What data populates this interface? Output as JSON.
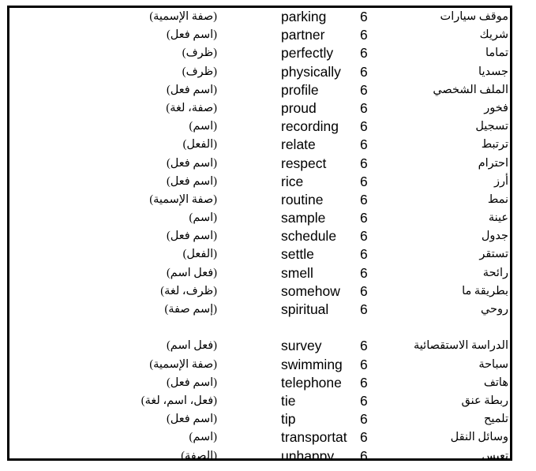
{
  "document": {
    "type": "vocabulary-table",
    "columns": [
      "part_of_speech",
      "english_word",
      "level",
      "arabic_meaning"
    ],
    "clipped_top_artifacts": [
      "..",
      "."
    ],
    "rows": [
      {
        "pos": "(صفة الإسمية)",
        "en": "parking",
        "num": "6",
        "ar": "موقف سيارات"
      },
      {
        "pos": "(اسم فعل)",
        "en": "partner",
        "num": "6",
        "ar": "شريك"
      },
      {
        "pos": "(ظرف)",
        "en": "perfectly",
        "num": "6",
        "ar": "تماما"
      },
      {
        "pos": "(ظرف)",
        "en": "physically",
        "num": "6",
        "ar": "جسديا"
      },
      {
        "pos": "(اسم فعل)",
        "en": "profile",
        "num": "6",
        "ar": "الملف الشخصي"
      },
      {
        "pos": "(صفة، لغة)",
        "en": "proud",
        "num": "6",
        "ar": "فخور"
      },
      {
        "pos": "(اسم)",
        "en": "recording",
        "num": "6",
        "ar": "تسجيل"
      },
      {
        "pos": "(الفعل)",
        "en": "relate",
        "num": "6",
        "ar": "ترتبط"
      },
      {
        "pos": "(اسم فعل)",
        "en": "respect",
        "num": "6",
        "ar": "احترام"
      },
      {
        "pos": "(اسم فعل)",
        "en": "rice",
        "num": "6",
        "ar": "أرز"
      },
      {
        "pos": "(صفة الإسمية)",
        "en": "routine",
        "num": "6",
        "ar": "نمط"
      },
      {
        "pos": "(اسم)",
        "en": "sample",
        "num": "6",
        "ar": "عينة"
      },
      {
        "pos": "(اسم فعل)",
        "en": "schedule",
        "num": "6",
        "ar": "جدول"
      },
      {
        "pos": "(الفعل)",
        "en": "settle",
        "num": "6",
        "ar": "تستقر"
      },
      {
        "pos": "(فعل اسم)",
        "en": "smell",
        "num": "6",
        "ar": "رائحة"
      },
      {
        "pos": "(ظرف، لغة)",
        "en": "somehow",
        "num": "6",
        "ar": "بطريقة ما"
      },
      {
        "pos": "(إسم صفة)",
        "en": "spiritual",
        "num": "6",
        "ar": "روحي"
      },
      {
        "pos": "",
        "en": "",
        "num": "",
        "ar": ""
      },
      {
        "pos": "(فعل اسم)",
        "en": "survey",
        "num": "6",
        "ar": "الدراسة الاستقصائية"
      },
      {
        "pos": "(صفة الإسمية)",
        "en": "swimming",
        "num": "6",
        "ar": "سباحة"
      },
      {
        "pos": "(اسم فعل)",
        "en": "telephone",
        "num": "6",
        "ar": "هاتف"
      },
      {
        "pos": "(فعل، اسم، لغة)",
        "en": "tie",
        "num": "6",
        "ar": "ربطة عنق"
      },
      {
        "pos": "(اسم فعل)",
        "en": "tip",
        "num": "6",
        "ar": "تلميح"
      },
      {
        "pos": "(اسم)",
        "en": "transportat",
        "num": "6",
        "ar": "وسائل النقل"
      },
      {
        "pos": "(الصفة)",
        "en": "unhappy",
        "num": "6",
        "ar": "تعيس"
      }
    ]
  }
}
